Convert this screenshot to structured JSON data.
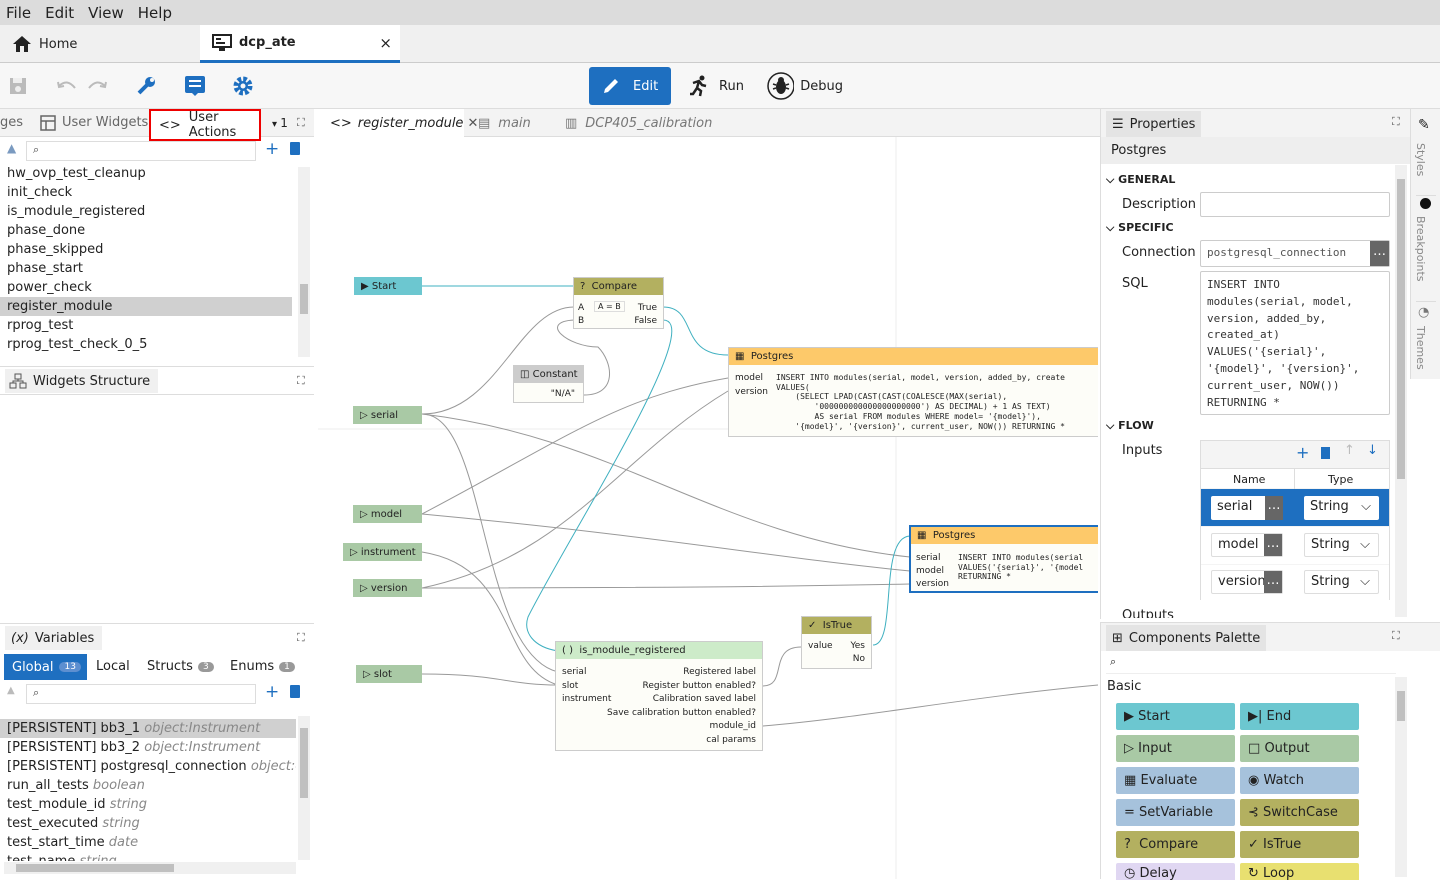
{
  "menu": [
    "File",
    "Edit",
    "View",
    "Help"
  ],
  "tabs": {
    "home": "Home",
    "project": "dcp_ate",
    "close": "×"
  },
  "modes": {
    "edit": "Edit",
    "run": "Run",
    "debug": "Debug"
  },
  "left_top": {
    "tab_pages": "ges",
    "tab_widgets": "User Widgets",
    "tab_actions": "User Actions",
    "count": "1",
    "items": [
      "hw_ovp_test_cleanup",
      "init_check",
      "is_module_registered",
      "phase_done",
      "phase_skipped",
      "phase_start",
      "power_check",
      "register_module",
      "rprog_test",
      "rprog_test_check_0_5"
    ]
  },
  "widgets_structure": "Widgets Structure",
  "variables": {
    "title": "Variables",
    "tabs": {
      "global": "Global",
      "global_count": "13",
      "local": "Local",
      "structs": "Structs",
      "structs_count": "3",
      "enums": "Enums",
      "enums_count": "1"
    },
    "items": [
      {
        "name": "[PERSISTENT] bb3_1",
        "type": "object:Instrument"
      },
      {
        "name": "[PERSISTENT] bb3_2",
        "type": "object:Instrument"
      },
      {
        "name": "[PERSISTENT] postgresql_connection",
        "type": "object:eez-flo"
      },
      {
        "name": "run_all_tests",
        "type": "boolean"
      },
      {
        "name": "test_module_id",
        "type": "string"
      },
      {
        "name": "test_executed",
        "type": "string"
      },
      {
        "name": "test_start_time",
        "type": "date"
      },
      {
        "name": "test_name",
        "type": "string"
      }
    ]
  },
  "editor_tabs": [
    "register_module",
    "main",
    "DCP405_calibration"
  ],
  "nodes": {
    "start": "Start",
    "compare": "Compare",
    "compare_a": "A",
    "compare_b": "B",
    "compare_expr": "A = B",
    "compare_true": "True",
    "compare_false": "False",
    "constant": "Constant",
    "constant_val": "\"N/A\"",
    "serial": "serial",
    "model": "model",
    "instrument": "instrument",
    "version": "version",
    "slot": "slot",
    "pg1": "Postgres",
    "pg1_in1": "model",
    "pg1_in2": "version",
    "pg1_sql": "INSERT INTO modules(serial, model, version, added_by, create\nVALUES(\n    (SELECT LPAD(CAST(CAST(COALESCE(MAX(serial),\n        '000000000000000000000') AS DECIMAL) + 1 AS TEXT)\n        AS serial FROM modules WHERE model= '{model}'),\n    '{model}', '{version}', current_user, NOW()) RETURNING *",
    "pg2": "Postgres",
    "pg2_in1": "serial",
    "pg2_in2": "model",
    "pg2_in3": "version",
    "pg2_sql": "INSERT INTO modules(serial\nVALUES('{serial}', '{model\nRETURNING *",
    "istrue": "IsTrue",
    "istrue_val": "value",
    "istrue_yes": "Yes",
    "istrue_no": "No",
    "imr": "is_module_registered",
    "imr_in": [
      "serial",
      "slot",
      "instrument"
    ],
    "imr_out": [
      "Registered label",
      "Register button enabled?",
      "Calibration saved label",
      "Save calibration button enabled?",
      "module_id",
      "cal params"
    ]
  },
  "properties": {
    "title": "Properties",
    "subtitle": "Postgres",
    "general": "GENERAL",
    "description": "Description",
    "specific": "SPECIFIC",
    "connection": "Connection",
    "connection_val": "postgresql_connection",
    "sql": "SQL",
    "sql_val": "INSERT INTO\nmodules(serial, model,\nversion, added_by,\ncreated_at)\nVALUES('{serial}',\n'{model}', '{version}',\ncurrent_user, NOW())\nRETURNING *",
    "flow": "FLOW",
    "inputs": "Inputs",
    "col_name": "Name",
    "col_type": "Type",
    "rows": [
      {
        "name": "serial",
        "type": "String"
      },
      {
        "name": "model",
        "type": "String"
      },
      {
        "name": "version",
        "type": "String"
      }
    ],
    "outputs": "Outputs"
  },
  "side_tabs": [
    "Styles",
    "Breakpoints",
    "Themes"
  ],
  "palette": {
    "title": "Components Palette",
    "group": "Basic",
    "items": [
      {
        "label": "Start",
        "color": "#6cc7d0"
      },
      {
        "label": "End",
        "color": "#6cc7d0"
      },
      {
        "label": "Input",
        "color": "#a9c9a5"
      },
      {
        "label": "Output",
        "color": "#a9c9a5"
      },
      {
        "label": "Evaluate",
        "color": "#a6c2dc"
      },
      {
        "label": "Watch",
        "color": "#a6c2dc"
      },
      {
        "label": "SetVariable",
        "color": "#a6c2dc"
      },
      {
        "label": "SwitchCase",
        "color": "#b3b060"
      },
      {
        "label": "Compare",
        "color": "#b3b060"
      },
      {
        "label": "IsTrue",
        "color": "#b3b060"
      },
      {
        "label": "Delay",
        "color": "#e0d7f2"
      },
      {
        "label": "Loop",
        "color": "#e8e070"
      }
    ]
  }
}
